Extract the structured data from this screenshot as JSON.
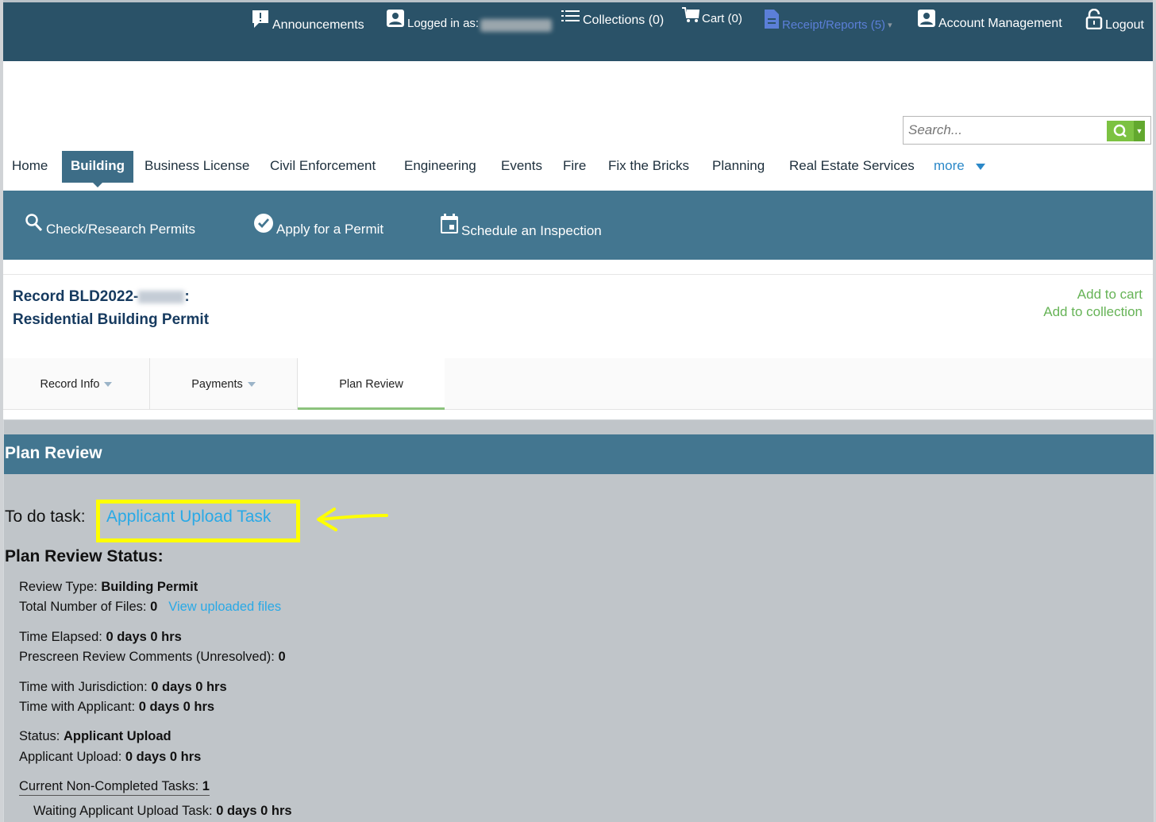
{
  "topbar": {
    "announcements": "Announcements",
    "logged_in_as": "Logged in as:",
    "collections": "Collections (0)",
    "cart": "Cart (0)",
    "receipts": "Receipt/Reports (5)",
    "account": "Account Management",
    "logout": "Logout"
  },
  "search": {
    "placeholder": "Search..."
  },
  "nav": {
    "items": [
      "Home",
      "Building",
      "Business License",
      "Civil Enforcement",
      "Engineering",
      "Events",
      "Fire",
      "Fix the Bricks",
      "Planning",
      "Real Estate Services"
    ],
    "more": "more",
    "active": "Building"
  },
  "subnav": {
    "check": "Check/Research Permits",
    "apply": "Apply for a Permit",
    "schedule": "Schedule an Inspection"
  },
  "record": {
    "id_prefix": "Record BLD2022-",
    "id_suffix": ":",
    "type": "Residential Building Permit",
    "add_cart": "Add to cart",
    "add_collection": "Add to collection"
  },
  "tabs": {
    "record_info": "Record Info",
    "payments": "Payments",
    "plan_review": "Plan Review"
  },
  "plan_review": {
    "header": "Plan Review",
    "todo_label": "To do task:",
    "todo_link": "Applicant Upload Task",
    "status_heading": "Plan Review Status:",
    "review_type_label": "Review Type: ",
    "review_type_value": "Building Permit",
    "total_files_label": "Total Number of Files: ",
    "total_files_value": "0",
    "view_files": "View uploaded files",
    "time_elapsed_label": "Time Elapsed: ",
    "time_elapsed_value": "0 days 0 hrs",
    "prescreen_label": "Prescreen Review Comments (Unresolved): ",
    "prescreen_value": "0",
    "jurisdiction_label": "Time with Jurisdiction: ",
    "jurisdiction_value": "0 days 0 hrs",
    "applicant_label": "Time with Applicant: ",
    "applicant_value": "0 days 0 hrs",
    "status_label": "Status: ",
    "status_value": "Applicant Upload",
    "applicant_upload_label": "Applicant Upload: ",
    "applicant_upload_value": "0 days 0 hrs",
    "noncompleted_label": "Current Non-Completed Tasks: ",
    "noncompleted_value": "1",
    "waiting_label": "Waiting Applicant Upload Task: ",
    "waiting_value": "0 days 0 hrs"
  },
  "colors": {
    "topbar": "#2a5268",
    "accent": "#437690",
    "link": "#29a9e6",
    "green": "#66b356",
    "highlight": "#ffff00"
  }
}
